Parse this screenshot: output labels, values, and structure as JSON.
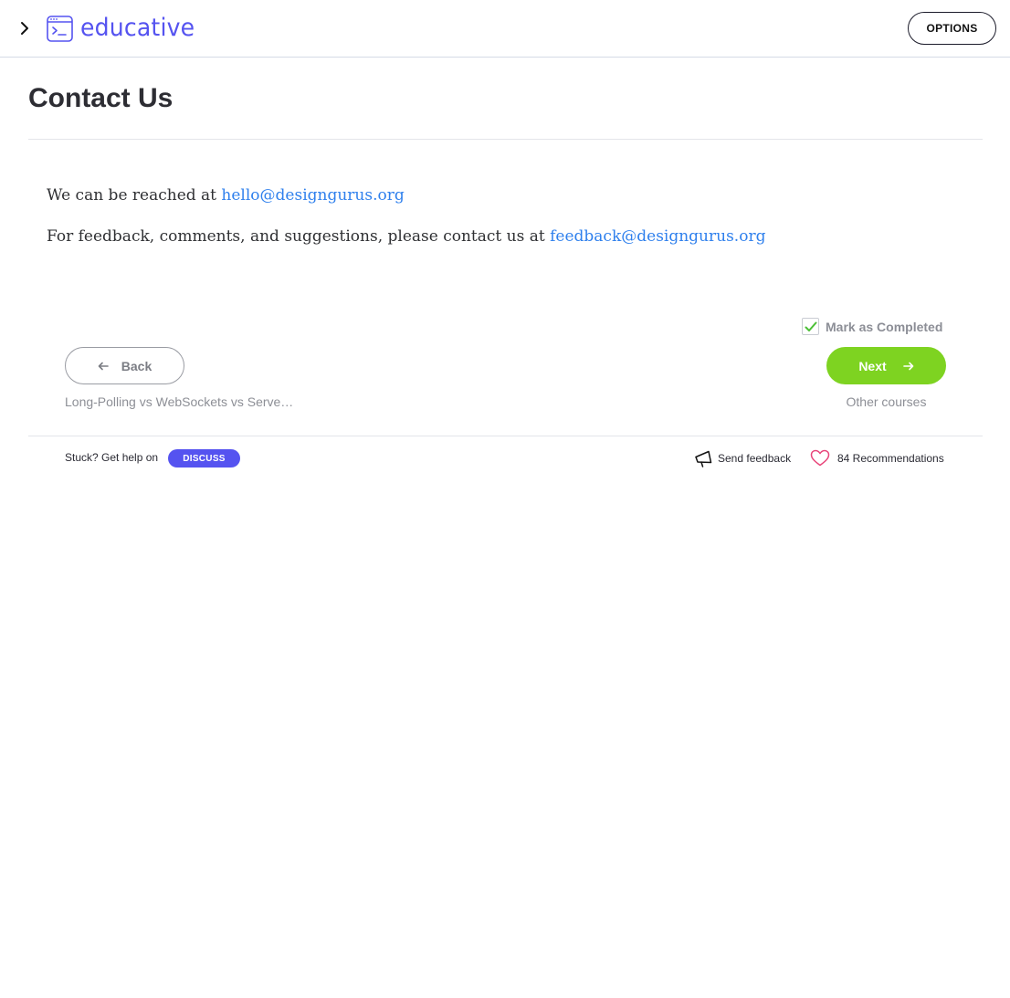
{
  "header": {
    "logo_text": "educative",
    "options_label": "OPTIONS",
    "brand_color": "#5553f0"
  },
  "page": {
    "title": "Contact Us"
  },
  "content": {
    "p1_text": "We can be reached at ",
    "p1_link": "hello@designgurus.org",
    "p2_text": "For feedback, comments, and suggestions, please contact us at ",
    "p2_link": "feedback@designgurus.org",
    "link_color": "#2f80ed"
  },
  "navigation": {
    "mark_completed_label": "Mark as Completed",
    "back_label": "Back",
    "next_label": "Next",
    "prev_lesson": "Long-Polling vs WebSockets vs Serve…",
    "next_lesson": "Other courses",
    "next_color": "#7ed321"
  },
  "footer": {
    "stuck_text": "Stuck? Get help on",
    "discuss_label": "DISCUSS",
    "send_feedback_label": "Send feedback",
    "recommendations_label": "84 Recommendations"
  }
}
